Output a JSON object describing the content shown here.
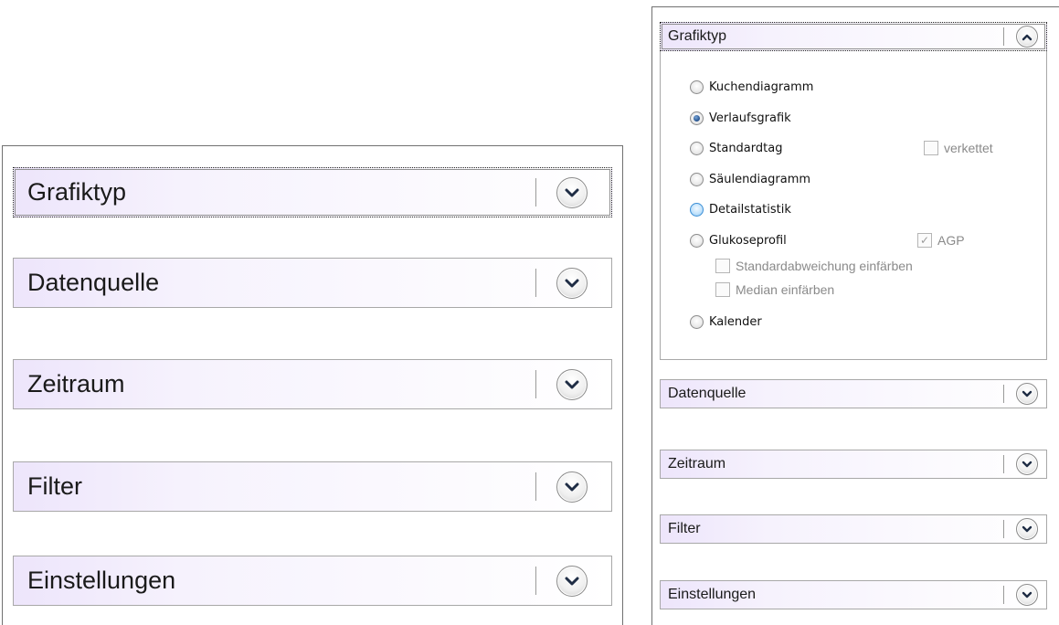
{
  "left_panel": {
    "sections": [
      {
        "title": "Grafiktyp",
        "expanded": false
      },
      {
        "title": "Datenquelle",
        "expanded": false
      },
      {
        "title": "Zeitraum",
        "expanded": false
      },
      {
        "title": "Filter",
        "expanded": false
      },
      {
        "title": "Einstellungen",
        "expanded": false
      }
    ]
  },
  "right_panel": {
    "grafiktyp": {
      "title": "Grafiktyp",
      "expanded": true,
      "options": [
        {
          "label": "Kuchendiagramm",
          "selected": false
        },
        {
          "label": "Verlaufsgrafik",
          "selected": true
        },
        {
          "label": "Standardtag",
          "selected": false
        },
        {
          "label": "Säulendiagramm",
          "selected": false
        },
        {
          "label": "Detailstatistik",
          "selected": false
        },
        {
          "label": "Glukoseprofil",
          "selected": false
        },
        {
          "label": "Kalender",
          "selected": false
        }
      ],
      "checkboxes": {
        "verkettet": {
          "label": "verkettet",
          "checked": false
        },
        "agp": {
          "label": "AGP",
          "checked": true
        },
        "standardabweichung": {
          "label": "Standardabweichung einfärben",
          "checked": false
        },
        "median": {
          "label": "Median einfärben",
          "checked": false
        }
      }
    },
    "sections": [
      {
        "title": "Datenquelle",
        "expanded": false
      },
      {
        "title": "Zeitraum",
        "expanded": false
      },
      {
        "title": "Filter",
        "expanded": false
      },
      {
        "title": "Einstellungen",
        "expanded": false
      }
    ]
  },
  "colors": {
    "header_gradient_start": "#ede5fb",
    "border": "#a8a8a8",
    "radio_selected": "#2c5a96",
    "radio_hover": "#7fc0ef"
  },
  "icons": {
    "collapsed": "chevron-down-icon",
    "expanded": "chevron-up-icon"
  }
}
